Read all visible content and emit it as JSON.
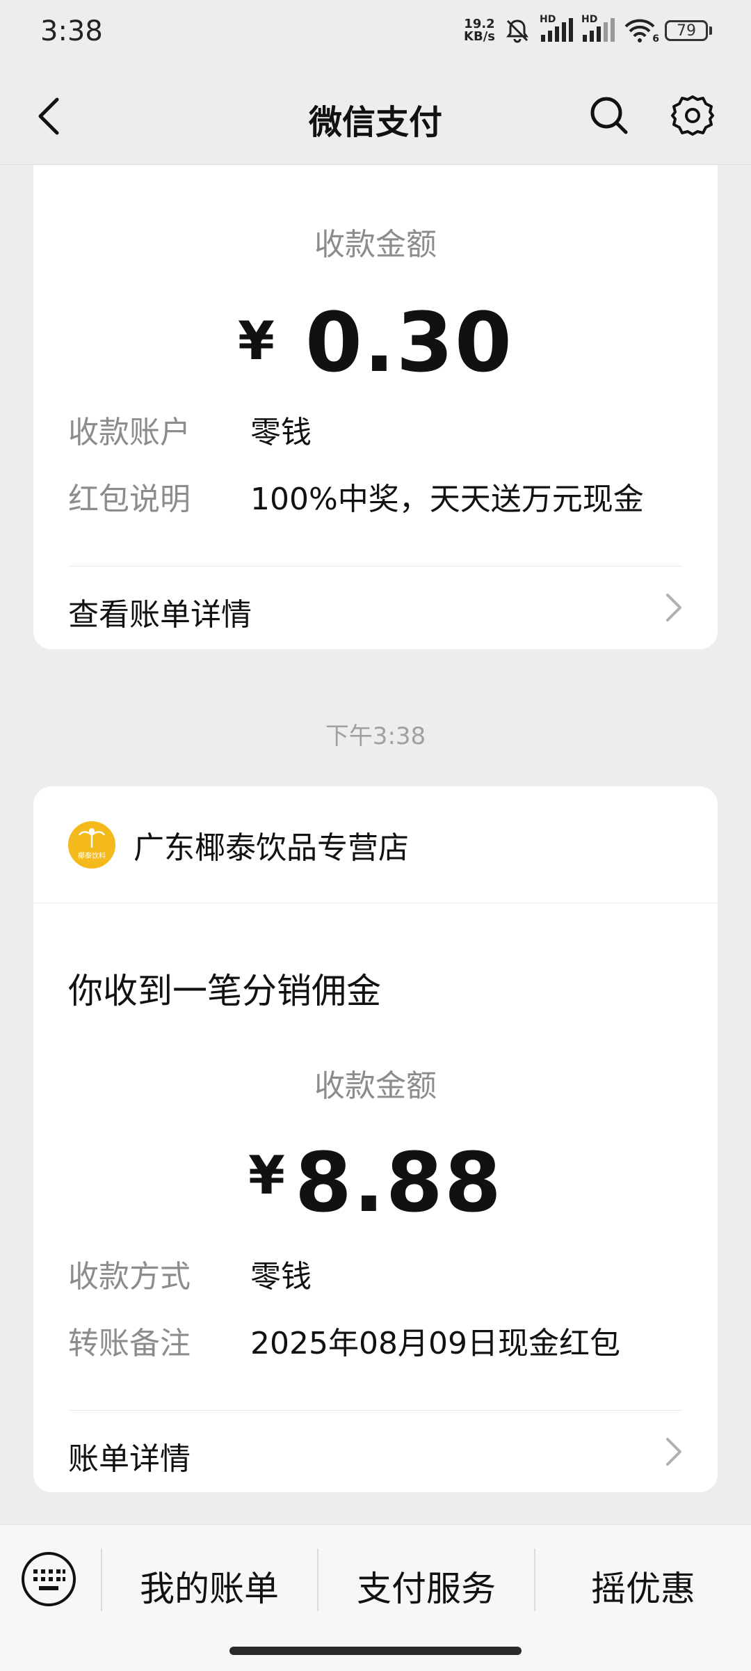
{
  "status_bar": {
    "time": "3:38",
    "net_speed_value": "19.2",
    "net_speed_unit": "KB/s",
    "signal1_label": "HD",
    "signal2_label": "HD",
    "wifi_label": "6",
    "battery": "79"
  },
  "nav": {
    "title": "微信支付"
  },
  "card1": {
    "amount_label": "收款金额",
    "currency": "¥",
    "amount": "0.30",
    "rows": [
      {
        "key": "收款账户",
        "value": "零钱"
      },
      {
        "key": "红包说明",
        "value": "100%中奖，天天送万元现金"
      }
    ],
    "link_label": "查看账单详情"
  },
  "timestamp": "下午3:38",
  "card2": {
    "merchant_name": "广东椰泰饮品专营店",
    "logo_text": "椰泰饮料",
    "message_title": "你收到一笔分销佣金",
    "amount_label": "收款金额",
    "currency": "¥",
    "amount": "8.88",
    "rows": [
      {
        "key": "收款方式",
        "value": "零钱"
      },
      {
        "key": "转账备注",
        "value": "2025年08月09日现金红包"
      }
    ],
    "link_label": "账单详情"
  },
  "bottom_bar": {
    "tabs": [
      "我的账单",
      "支付服务",
      "摇优惠"
    ]
  },
  "colors": {
    "background": "#ededed",
    "card": "#ffffff",
    "secondary_text": "#8c8c8c",
    "logo_yellow": "#f4b91a"
  }
}
